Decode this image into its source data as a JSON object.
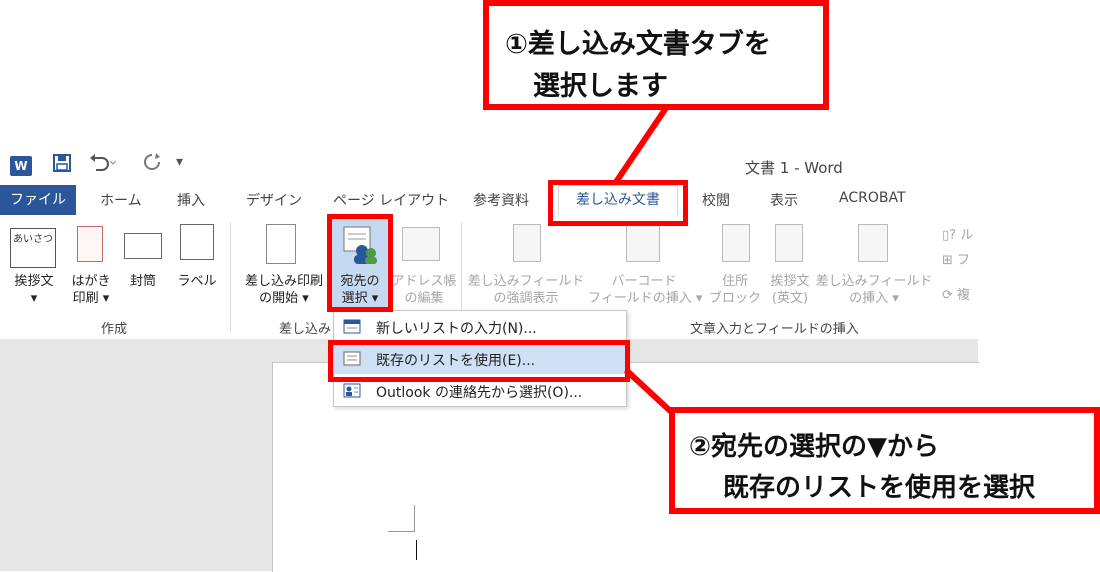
{
  "window": {
    "title": "文書 1 - Word",
    "app_icon": "word-icon",
    "quick_access": [
      "save-icon",
      "undo-icon",
      "redo-icon",
      "customize-icon"
    ]
  },
  "tabs": [
    "ファイル",
    "ホーム",
    "挿入",
    "デザイン",
    "ページ レイアウト",
    "参考資料",
    "差し込み文書",
    "校閲",
    "表示",
    "ACROBAT"
  ],
  "ribbon": {
    "create_group": {
      "label": "作成",
      "greeting_line1": "挨拶文",
      "greeting_icon_text": "あいさつ",
      "postcard_line1": "はがき",
      "postcard_line2": "印刷",
      "envelope": "封筒",
      "label_btn": "ラベル"
    },
    "start_group": {
      "label": "差し込み",
      "start_line1": "差し込み印刷",
      "start_line2": "の開始",
      "recipients_line1": "宛先の",
      "recipients_line2": "選択",
      "address_line1": "アドレス帳",
      "address_line2": "の編集"
    },
    "write_group": {
      "label": "文章入力とフィールドの挿入",
      "highlight_line1": "差し込みフィールド",
      "highlight_line2": "の強調表示",
      "barcode_line1": "バーコード",
      "barcode_line2": "フィールドの挿入",
      "address_block_line1": "住所",
      "address_block_line2": "ブロック",
      "greeting_en_line1": "挨拶文",
      "greeting_en_line2": "(英文)",
      "insert_field_line1": "差し込みフィールド",
      "insert_field_line2": "の挿入",
      "rules": "ル",
      "match": "フ",
      "update": "複"
    }
  },
  "dropdown": {
    "items": [
      "新しいリストの入力(N)...",
      "既存のリストを使用(E)...",
      "Outlook の連絡先から選択(O)..."
    ]
  },
  "callouts": {
    "step1_line1": "①差し込み文書タブを",
    "step1_line2": "選択します",
    "step2_line1": "②宛先の選択の▼から",
    "step2_line2": "既存のリストを使用を選択"
  },
  "colors": {
    "accent": "#2b579a",
    "highlight": "#ff0000",
    "menu_hover": "#cfe0f4"
  }
}
